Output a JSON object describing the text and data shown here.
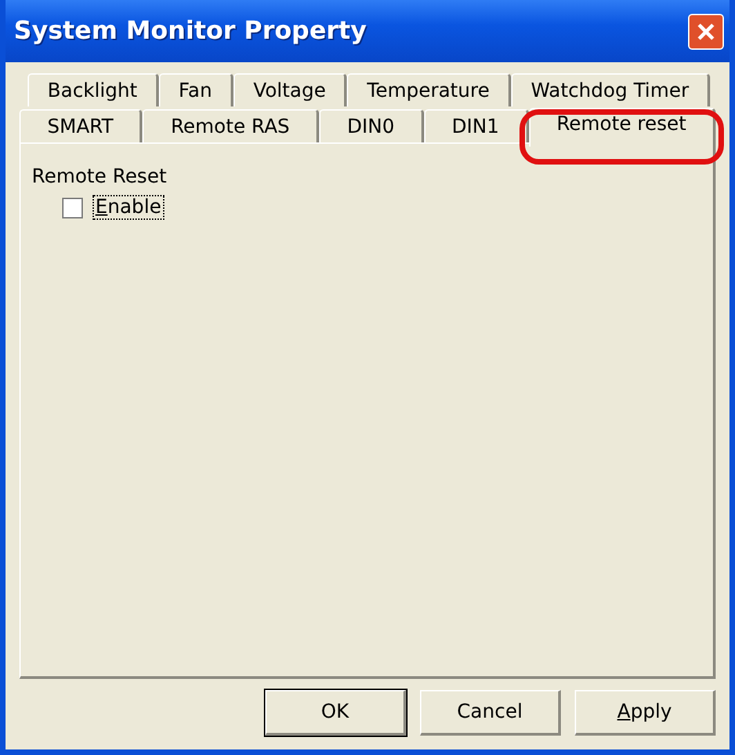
{
  "window": {
    "title": "System Monitor Property"
  },
  "tab_rows": [
    [
      {
        "label": "Backlight",
        "selected": false
      },
      {
        "label": "Fan",
        "selected": false
      },
      {
        "label": "Voltage",
        "selected": false
      },
      {
        "label": "Temperature",
        "selected": false
      },
      {
        "label": "Watchdog Timer",
        "selected": false
      }
    ],
    [
      {
        "label": "SMART",
        "selected": false
      },
      {
        "label": "Remote RAS",
        "selected": false
      },
      {
        "label": "DIN0",
        "selected": false
      },
      {
        "label": "DIN1",
        "selected": false
      },
      {
        "label": "Remote reset",
        "selected": true
      }
    ]
  ],
  "group": {
    "label": "Remote Reset",
    "checkbox": {
      "label": "Enable",
      "checked": false,
      "focused": true,
      "underline_first": true
    }
  },
  "buttons": [
    {
      "label": "OK",
      "default": true
    },
    {
      "label": "Cancel",
      "default": false
    },
    {
      "label": "Apply",
      "default": false,
      "underline_first": true
    }
  ],
  "annotation": {
    "kind": "oval",
    "color": "#e01010"
  }
}
